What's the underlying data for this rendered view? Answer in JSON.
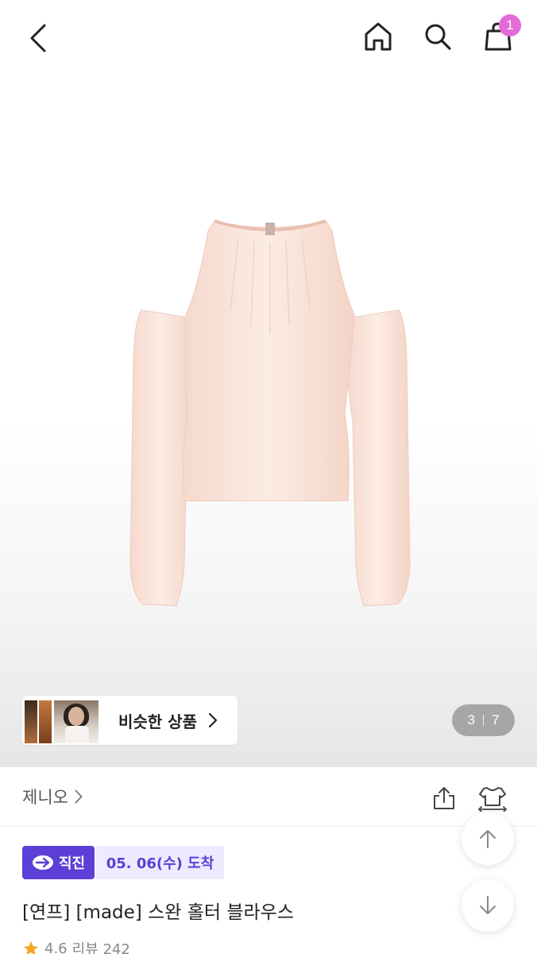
{
  "header": {
    "cart_count": "1"
  },
  "gallery": {
    "current": "3",
    "total": "7",
    "similar_label": "비슷한 상품"
  },
  "brand": {
    "name": "제니오"
  },
  "delivery": {
    "direct_label": "직진",
    "arrival_label": "05. 06(수) 도착"
  },
  "product": {
    "title": "[연프] [made] 스완 홀터 블라우스",
    "rating": "4.6",
    "review_label": "리뷰 242"
  },
  "colors": {
    "accent": "#5b3fd6",
    "badge": "#e36bd9",
    "star": "#f5a623"
  },
  "icons": [
    "back-icon",
    "home-icon",
    "search-icon",
    "cart-icon",
    "chevron-right-icon",
    "share-icon",
    "fit-icon",
    "arrow-up-icon",
    "arrow-down-icon",
    "star-icon"
  ]
}
